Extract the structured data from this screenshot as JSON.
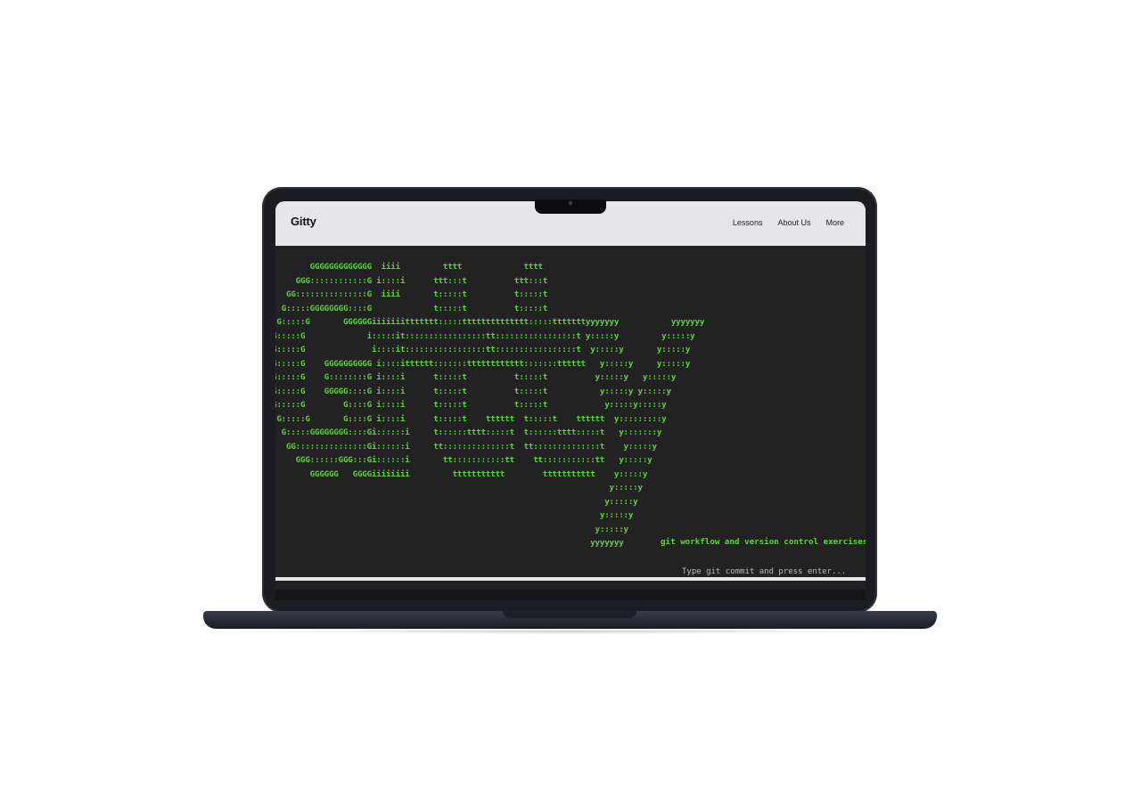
{
  "nav": {
    "brand": "Gitty",
    "links": [
      "Lessons",
      "About Us",
      "More"
    ]
  },
  "terminal": {
    "ascii_art": "        GGGGGGGGGGGGG  iiii         tttt             tttt\n     GGG::::::::::::G i::::i      ttt:::t          ttt:::t\n   GG:::::::::::::::G  iiii       t:::::t          t:::::t\n  G:::::GGGGGGGG::::G             t:::::t          t:::::t\n G:::::G       GGGGGGiiiiiiittttttt:::::tttttttttttttt:::::tttttttyyyyyyy           yyyyyyy\nG:::::G             i:::::it:::::::::::::::::tt:::::::::::::::::t y:::::y         y:::::y\nG:::::G              i::::it:::::::::::::::::tt:::::::::::::::::t  y:::::y       y:::::y\nG:::::G    GGGGGGGGGG i::::itttttt:::::::tttttttttttt:::::::tttttt   y:::::y     y:::::y\nG:::::G    G::::::::G i::::i      t:::::t          t:::::t          y:::::y   y:::::y\nG:::::G    GGGGG::::G i::::i      t:::::t          t:::::t           y:::::y y:::::y\nG:::::G        G::::G i::::i      t:::::t          t:::::t            y:::::y:::::y\n G:::::G       G::::G i::::i      t:::::t    tttttt  t:::::t    tttttt  y:::::::::y\n  G:::::GGGGGGGG::::Gi::::::i     t::::::tttt:::::t  t::::::tttt:::::t   y:::::::y\n   GG:::::::::::::::Gi::::::i     tt::::::::::::::t  tt::::::::::::::t    y:::::y\n     GGG::::::GGG:::Gi::::::i       tt:::::::::::tt    tt:::::::::::tt   y:::::y\n        GGGGGG   GGGGiiiiiiii         ttttttttttt        ttttttttttt    y:::::y\n                                                                       y:::::y\n                                                                      y:::::y\n                                                                     y:::::y\n                                                                    y:::::y\n                                                                   yyyyyyy",
    "tagline": "git workflow and version control exercises",
    "command_placeholder": "Type git commit and press enter..."
  }
}
